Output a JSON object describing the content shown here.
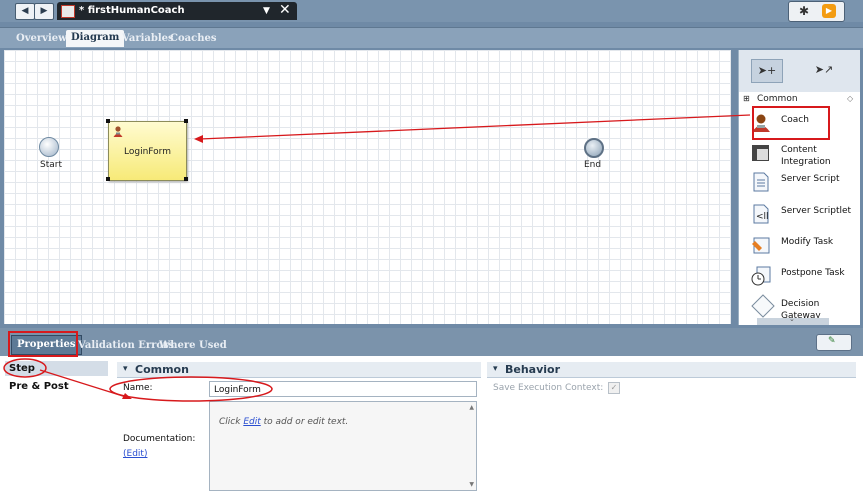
{
  "window": {
    "nav_back": "◀",
    "nav_forward": "▶",
    "doc_tab_title": "* firstHumanCoach",
    "doc_tab_dropdown": "▼",
    "doc_tab_close": "✕"
  },
  "editor_tabs": [
    "Overview",
    "Diagram",
    "Variables",
    "Coaches"
  ],
  "canvas": {
    "start_label": "Start",
    "end_label": "End",
    "task_label": "LoginForm"
  },
  "palette": {
    "section": "Common",
    "items": [
      {
        "label": "Coach",
        "icon": "coach-icon"
      },
      {
        "label": "Content Integration",
        "icon": "content-integration-icon"
      },
      {
        "label": "Server Script",
        "icon": "server-script-icon"
      },
      {
        "label": "Server Scriptlet",
        "icon": "server-scriptlet-icon"
      },
      {
        "label": "Modify Task",
        "icon": "modify-task-icon"
      },
      {
        "label": "Postpone Task",
        "icon": "postpone-task-icon"
      },
      {
        "label": "Decision Gateway",
        "icon": "decision-gateway-icon"
      }
    ]
  },
  "bottom_tabs": [
    "Properties",
    "Validation Errors",
    "Where Used"
  ],
  "properties": {
    "nav": [
      "Step",
      "Pre & Post"
    ],
    "common_header": "Common",
    "behavior_header": "Behavior",
    "name_label": "Name:",
    "name_value": "LoginForm",
    "doc_label": "Documentation:",
    "doc_edit_link": "(Edit)",
    "doc_hint_prefix": "Click ",
    "doc_hint_link": "Edit",
    "doc_hint_suffix": " to add or edit text.",
    "save_context_label": "Save Execution Context:",
    "save_context_checked": true
  },
  "annotation_color": "#d7191c"
}
